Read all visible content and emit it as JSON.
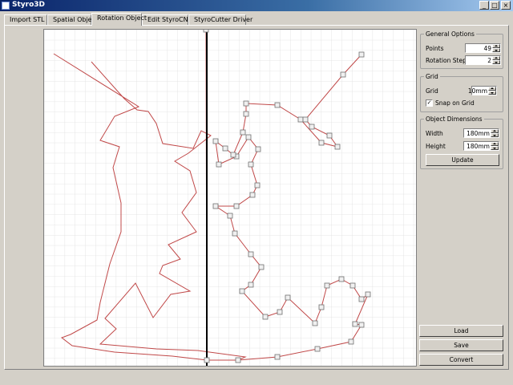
{
  "window": {
    "title": "Styro3D"
  },
  "tabs": [
    {
      "label": "Import STL"
    },
    {
      "label": "Spatial Object"
    },
    {
      "label": "Rotation Object",
      "active": true
    },
    {
      "label": "Edit StyroCNC"
    },
    {
      "label": "StyroCutter Driver"
    }
  ],
  "general_options": {
    "title": "General Options",
    "points_label": "Points",
    "points_value": "49",
    "rotation_label": "Rotation Steps",
    "rotation_value": "2"
  },
  "grid": {
    "title": "Grid",
    "grid_label": "Grid",
    "grid_value": "10mm",
    "snap_label": "Snap on Grid",
    "snap_checked": true
  },
  "dimensions": {
    "title": "Object Dimensions",
    "width_label": "Width",
    "width_value": "180mm",
    "height_label": "Height",
    "height_value": "180mm",
    "update_label": "Update"
  },
  "actions": {
    "load_label": "Load",
    "save_label": "Save",
    "convert_label": "Convert"
  },
  "colors": {
    "profile_line": "#c04848",
    "axis_line": "#000000",
    "grid_line": "#e0e0e0"
  }
}
